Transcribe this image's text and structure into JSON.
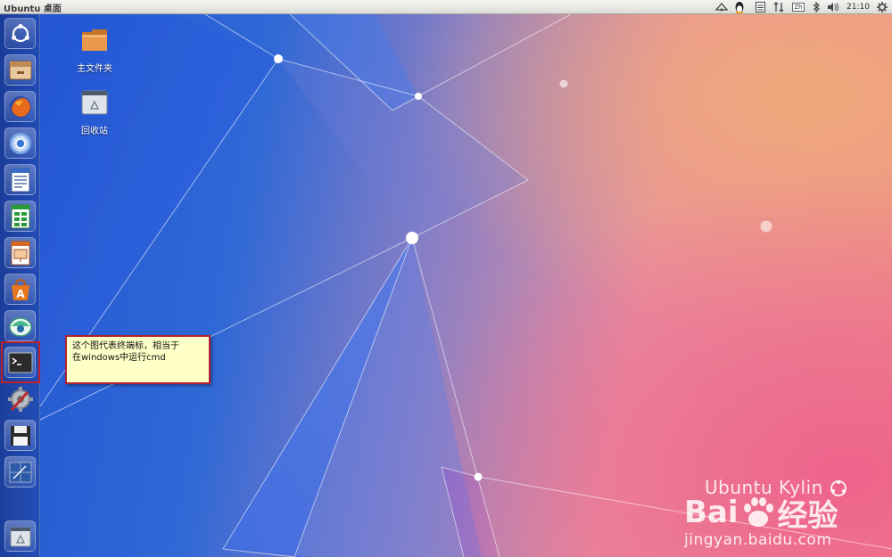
{
  "panel": {
    "title": "Ubuntu 桌面",
    "clock": "21:10",
    "indicators": [
      "network-icon",
      "qq-penguin-icon",
      "keyboard-icon",
      "transfer-icon",
      "input-method-icon",
      "bluetooth-icon",
      "volume-icon",
      "gear-icon"
    ],
    "input_method_label": "Zh"
  },
  "launcher": {
    "items": [
      {
        "name": "dash-home-icon"
      },
      {
        "name": "file-manager-icon"
      },
      {
        "name": "firefox-icon"
      },
      {
        "name": "chromium-icon"
      },
      {
        "name": "writer-icon"
      },
      {
        "name": "calc-icon"
      },
      {
        "name": "impress-icon"
      },
      {
        "name": "software-center-icon"
      },
      {
        "name": "kylin-assistant-icon"
      },
      {
        "name": "terminal-icon"
      },
      {
        "name": "system-settings-icon"
      },
      {
        "name": "floppy-save-icon"
      },
      {
        "name": "workspace-switcher-icon"
      },
      {
        "name": "trash-icon"
      }
    ]
  },
  "desktop": {
    "icons": [
      {
        "label": "主文件夹",
        "name": "home-folder-icon"
      },
      {
        "label": "回收站",
        "name": "trash-icon"
      }
    ]
  },
  "callout": {
    "line1": "这个图代表终端标，相当于",
    "line2": "在windows中运行cmd"
  },
  "watermark": {
    "kylin_text": "Ubuntu Kylin",
    "baidu_left": "Bai",
    "baidu_right": "经验",
    "url": "jingyan.baidu.com"
  },
  "colors": {
    "highlight_border": "#c0202a",
    "callout_bg": "#ffffc8",
    "panel_bg": "#e4e4e0"
  }
}
